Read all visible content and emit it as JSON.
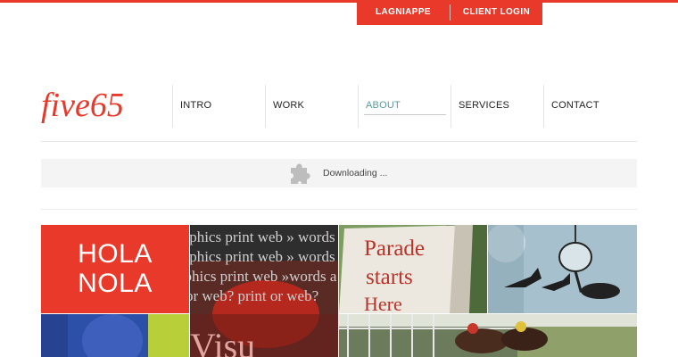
{
  "topbar": {
    "lagniappe": "LAGNIAPPE",
    "client_login": "CLIENT LOGIN",
    "color": "#e8392a"
  },
  "logo": {
    "text": "five65",
    "color": "#e8392a"
  },
  "nav": {
    "intro": "INTRO",
    "work": "WORK",
    "about": "ABOUT",
    "services": "SERVICES",
    "contact": "CONTACT",
    "active": "about"
  },
  "download": {
    "text": "Downloading ...",
    "icon": "puzzle-piece-icon"
  },
  "tiles": {
    "hola_line1": "HOLA",
    "hola_line2": "NOLA",
    "type_rows": [
      "raphics print web  »  words a",
      "raphics print web  »  words",
      "aphics print web »words a",
      "t or web? print or web?",
      "Visu"
    ],
    "parade_sign": [
      "Parade",
      "starts",
      "Here"
    ]
  }
}
